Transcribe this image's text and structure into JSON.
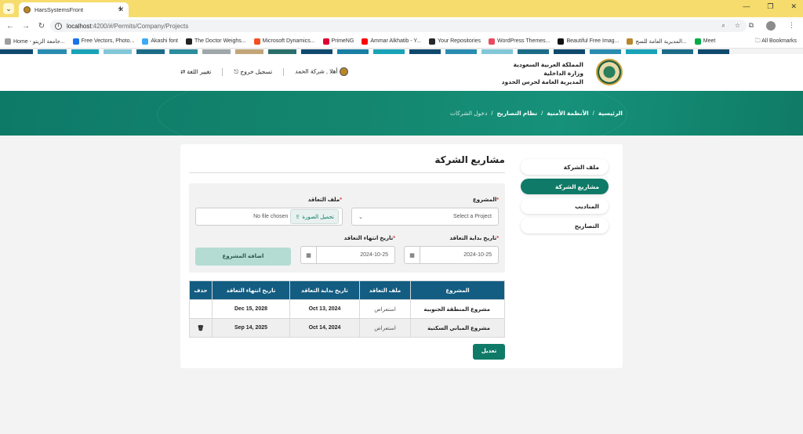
{
  "browser": {
    "tab_title": "HarsSystemsFront",
    "url_host": "localhost",
    "url_path": ":4200/#/Permits/Company/Projects",
    "bookmarks": [
      {
        "label": "Home - جامعة الزيتو...",
        "color": "#9e9e9e"
      },
      {
        "label": "Free Vectors, Photo...",
        "color": "#1a73e8"
      },
      {
        "label": "Akashi font",
        "color": "#3fa9f5"
      },
      {
        "label": "The Doctor Weighs...",
        "color": "#222222"
      },
      {
        "label": "Microsoft Dynamics...",
        "color": "#f25022"
      },
      {
        "label": "PrimeNG",
        "color": "#dd0031"
      },
      {
        "label": "Ammar Alkhatib - Y...",
        "color": "#ff0000"
      },
      {
        "label": "Your Repositories",
        "color": "#24292e"
      },
      {
        "label": "WordPress Themes...",
        "color": "#e84a5f"
      },
      {
        "label": "Beautiful Free Imag...",
        "color": "#111111"
      },
      {
        "label": "المديرية العامة للسج...",
        "color": "#b8862b"
      },
      {
        "label": "Meet",
        "color": "#00ac47"
      }
    ],
    "all_bookmarks": "All Bookmarks"
  },
  "header": {
    "line1": "المملكة العربية السعودية",
    "line2": "وزارة الداخلية",
    "line3": "المديرية العامة لحرس الحدود",
    "greeting": "أهلا , شركة الحمد",
    "logout": "تسجيل خروج",
    "language": "تغيير اللغة"
  },
  "breadcrumb": {
    "home": "الرئيسية",
    "security": "الأنظمة الأمنية",
    "permits": "نظام التصاريح",
    "current": "دخول الشركات",
    "sep": "/"
  },
  "sidebar": {
    "items": [
      {
        "label": "ملف الشركة"
      },
      {
        "label": "مشاريع الشركة"
      },
      {
        "label": "المناديب"
      },
      {
        "label": "التصاريح"
      }
    ]
  },
  "page": {
    "title": "مشاريع الشركة"
  },
  "form": {
    "project_label": "المشروع",
    "project_placeholder": "Select a Project",
    "contract_file_label": "ملف التعاقد",
    "upload_label": "تحميل الصورة",
    "no_file": "No file chosen",
    "start_label": "تاريخ بداية التعاقد",
    "start_value": "2024-10-25",
    "end_label": "تاريخ انتهاء التعاقد",
    "end_value": "2024-10-25",
    "add_button": "اضافة المشروع",
    "required_mark": "*"
  },
  "table": {
    "headers": {
      "project": "المشروع",
      "file": "ملف التعاقد",
      "start": "تاريخ بداية التعاقد",
      "end": "تاريخ انتهاء التعاقد",
      "delete": "حذف"
    },
    "rows": [
      {
        "project": "مشروع المنطقة الجنوبية",
        "file": "استعراض",
        "start": "Oct 13, 2024",
        "end": "Dec 15, 2028",
        "deletable": false
      },
      {
        "project": "مشروع المباني السكنية",
        "file": "استعراض",
        "start": "Oct 14, 2024",
        "end": "Sep 14, 2025",
        "deletable": true
      }
    ]
  },
  "edit_button": "تعديل",
  "colors": {
    "primary": "#0f7a67",
    "table_header": "#135c82"
  }
}
